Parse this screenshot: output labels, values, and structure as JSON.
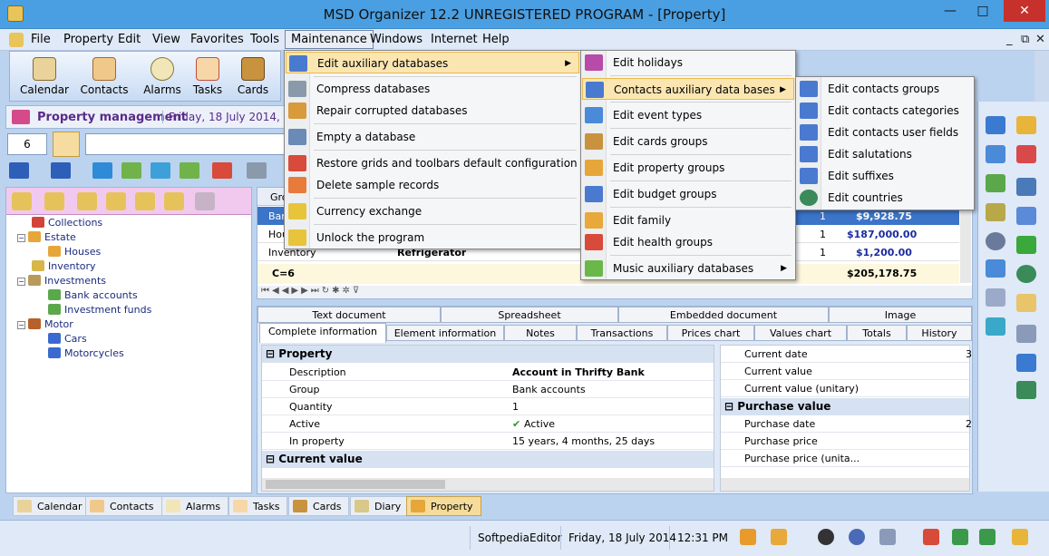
{
  "window": {
    "title": "MSD Organizer 12.2 UNREGISTERED PROGRAM - [Property]",
    "min": "—",
    "max": "□",
    "close": "✕",
    "mdi_min": "_",
    "mdi_restore": "⧉",
    "mdi_close": "✕"
  },
  "menubar": [
    "File",
    "Property",
    "Edit",
    "View",
    "Favorites",
    "Tools",
    "Maintenance",
    "Windows",
    "Internet",
    "Help"
  ],
  "toolbar": [
    {
      "label": "Calendar"
    },
    {
      "label": "Contacts"
    },
    {
      "label": "Alarms"
    },
    {
      "label": "Tasks"
    },
    {
      "label": "Cards"
    }
  ],
  "header": {
    "title": "Property management",
    "date": "Friday, 18 July 2014, we"
  },
  "qty_field": "6",
  "maintenance_menu": [
    {
      "label": "Edit auxiliary databases",
      "u": "a"
    },
    {
      "label": "Compress databases"
    },
    {
      "label": "Repair corrupted databases"
    },
    {
      "label": "Empty a database"
    },
    {
      "label": "Restore grids and toolbars default configuration"
    },
    {
      "label": "Delete sample records"
    },
    {
      "label": "Currency exchange"
    },
    {
      "label": "Unlock the program"
    }
  ],
  "aux_menu": [
    {
      "label": "Edit holidays"
    },
    {
      "label": "Contacts auxiliary data bases"
    },
    {
      "label": "Edit event types"
    },
    {
      "label": "Edit cards groups"
    },
    {
      "label": "Edit property groups"
    },
    {
      "label": "Edit budget groups"
    },
    {
      "label": "Edit family"
    },
    {
      "label": "Edit health groups"
    },
    {
      "label": "Music auxiliary databases"
    }
  ],
  "contacts_menu": [
    {
      "label": "Edit contacts groups"
    },
    {
      "label": "Edit contacts categories"
    },
    {
      "label": "Edit contacts user fields"
    },
    {
      "label": "Edit salutations"
    },
    {
      "label": "Edit suffixes"
    },
    {
      "label": "Edit countries"
    }
  ],
  "tree": [
    {
      "label": "Collections",
      "level": 1
    },
    {
      "label": "Estate",
      "level": 0
    },
    {
      "label": "Houses",
      "level": 2
    },
    {
      "label": "Inventory",
      "level": 1
    },
    {
      "label": "Investments",
      "level": 0
    },
    {
      "label": "Bank accounts",
      "level": 2
    },
    {
      "label": "Investment funds",
      "level": 2
    },
    {
      "label": "Motor",
      "level": 0
    },
    {
      "label": "Cars",
      "level": 2
    },
    {
      "label": "Motorcycles",
      "level": 2
    }
  ],
  "grid": {
    "header": "Gro",
    "rows": [
      {
        "group": "Ban",
        "qty": "1",
        "value": "$9,928.75",
        "selected": true
      },
      {
        "group": "Hou",
        "qty": "1",
        "value": "$187,000.00"
      },
      {
        "group": "Inventory",
        "desc": "Refrigerator",
        "qty": "1",
        "value": "$1,200.00"
      }
    ],
    "count": "C=6",
    "total": "$205,178.75"
  },
  "tabs_top": [
    "Text document",
    "Spreadsheet",
    "Embedded document",
    "Image"
  ],
  "tabs_bottom": [
    "Complete information",
    "Element information",
    "Notes",
    "Transactions",
    "Prices chart",
    "Values chart",
    "Totals",
    "History"
  ],
  "property": {
    "section": "Property",
    "rows": [
      {
        "k": "Description",
        "v": "Account in Thrifty Bank"
      },
      {
        "k": "Group",
        "v": "Bank accounts"
      },
      {
        "k": "Quantity",
        "v": "1"
      },
      {
        "k": "Active",
        "v": "Active"
      },
      {
        "k": "In property",
        "v": "15 years, 4 months, 25 days"
      }
    ],
    "section2": "Current value"
  },
  "rightprops": {
    "rows1": [
      "Current date",
      "Current value",
      "Current value (unitary)"
    ],
    "section": "Purchase value",
    "rows2": [
      "Purchase date",
      "Purchase price",
      "Purchase price (unita..."
    ],
    "col3a": "3",
    "col3b": "2"
  },
  "bottom_tabs": [
    "Calendar",
    "Contacts",
    "Alarms",
    "Tasks",
    "Cards",
    "Diary",
    "Property"
  ],
  "status": {
    "user": "SoftpediaEditor",
    "date": "Friday, 18 July 2014",
    "time": "12:31 PM"
  },
  "colors": {
    "accent": "#4a9fe2",
    "highlight": "#fbe6b2",
    "selection": "#3b74c8"
  }
}
